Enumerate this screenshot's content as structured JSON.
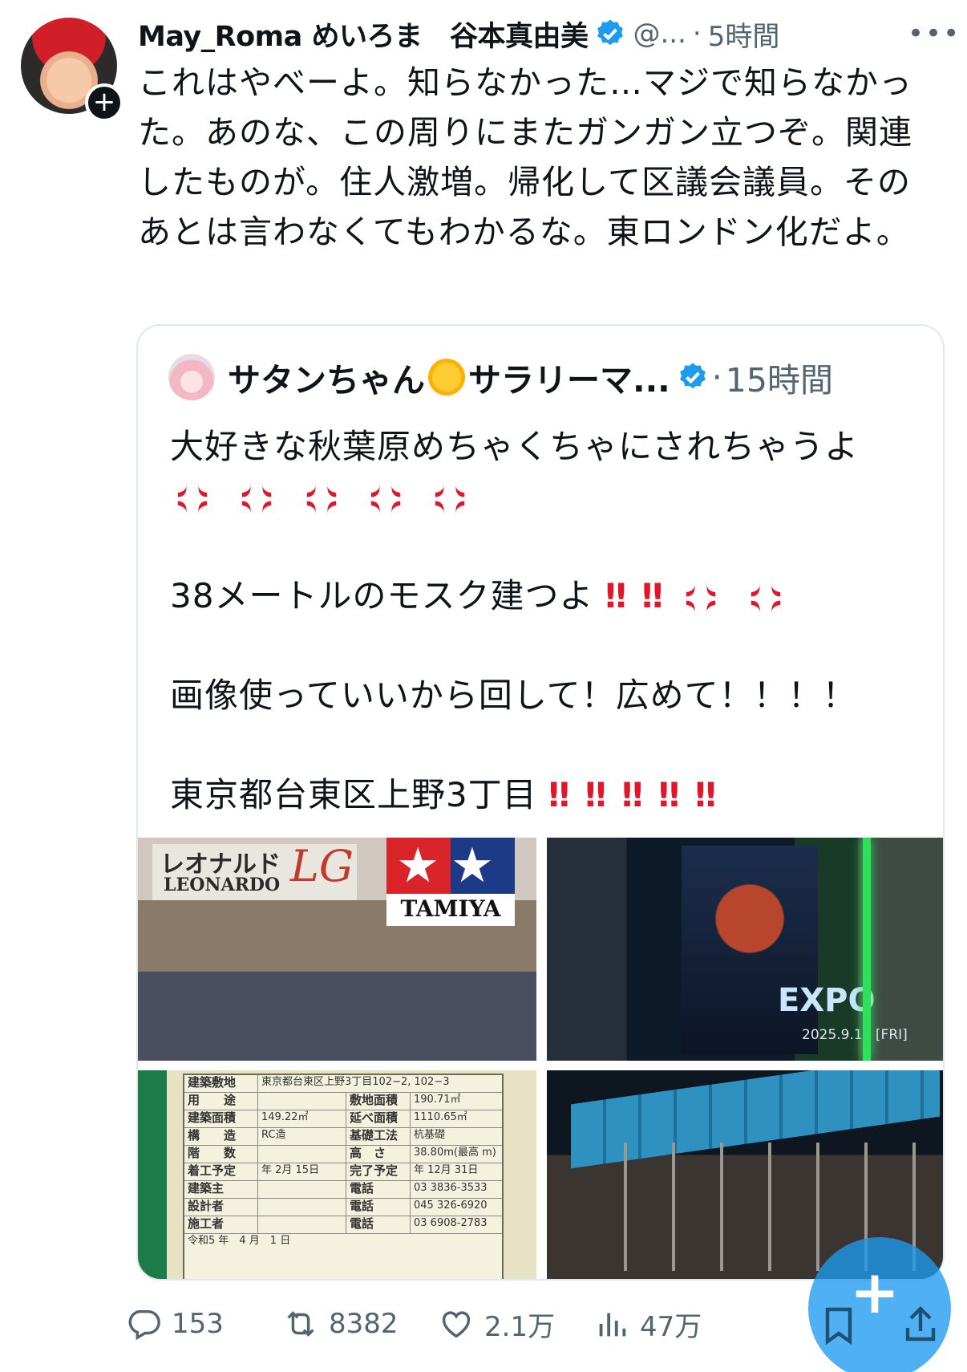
{
  "post": {
    "display_name": "May_Roma めいろま　谷本真由美",
    "handle": "@...",
    "separator": "·",
    "time": "5時間",
    "more_label": "•••",
    "text": "これはやべーよ。知らなかった…マジで知らなかった。あのな、この周りにまたガンガン立つぞ。関連したものが。住人激増。帰化して区議会議員。そのあとは言わなくてもわかるな。東ロンドン化だよ。",
    "follow_label": "+"
  },
  "quote": {
    "display_name_1": "サタンちゃん",
    "display_name_2": "サラリーマ...",
    "separator": "·",
    "time": "15時間",
    "line1": "大好きな秋葉原めちゃくちゃにされちゃうよ",
    "line2": "38メートルのモスク建つよ",
    "line3": "画像使っていいから回して！広めて！！！！",
    "line4": "東京都台東区上野3丁目",
    "bang": "‼"
  },
  "media": {
    "tile1": {
      "sign_jp": "レオナルド",
      "sign_en": "LEONARDO",
      "sign_lg": "LG",
      "tamiya_stars": "★★",
      "tamiya_word": "TAMIYA"
    },
    "tile2": {
      "expo_word": "EXPO",
      "expo_date": "2025.9.12 [FRI]"
    },
    "tile3": {
      "rows": [
        {
          "k": "用　　途",
          "v": "",
          "k2": "敷地面積",
          "v2": "190.71㎡"
        },
        {
          "k": "建築面積",
          "v": "149.22㎡",
          "k2": "延べ面積",
          "v2": "1110.65㎡"
        },
        {
          "k": "構　　造",
          "v": "RC造",
          "k2": "基礎工法",
          "v2": "杭基礎"
        },
        {
          "k": "階　　数",
          "v": "",
          "k2": "高　さ",
          "v2": "38.80m(最高 m)"
        },
        {
          "k": "着工予定",
          "v": "年 2月 15日",
          "k2": "完了予定",
          "v2": "年 12月 31日"
        },
        {
          "k": "建築主",
          "v": "",
          "k2": "電話",
          "v2": "03 3836-3533"
        },
        {
          "k": "設計者",
          "v": "",
          "k2": "電話",
          "v2": "045 326-6920"
        },
        {
          "k": "施工者",
          "v": "",
          "k2": "電話",
          "v2": "03 6908-2783"
        }
      ],
      "address": "東京都台東区上野3丁目102−2, 102−3",
      "footer": "令和5 年　4 月　1 日"
    }
  },
  "actions": {
    "replies": "153",
    "reposts": "8382",
    "likes": "2.1万",
    "views": "47万"
  },
  "fab": {
    "label": "+"
  },
  "colors": {
    "accent": "#1d9bf0",
    "muted": "#536471",
    "anger": "#e0162b"
  }
}
